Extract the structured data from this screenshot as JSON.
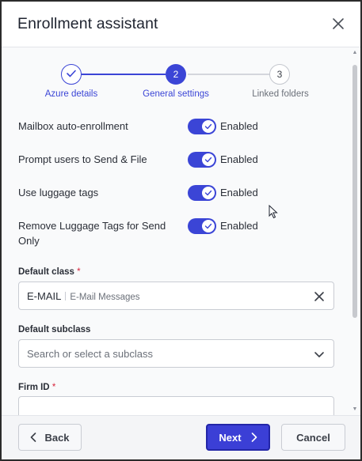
{
  "dialog": {
    "title": "Enrollment assistant",
    "close_icon": "close-icon"
  },
  "stepper": {
    "steps": [
      {
        "label": "Azure details",
        "number": "",
        "state": "completed"
      },
      {
        "label": "General settings",
        "number": "2",
        "state": "active"
      },
      {
        "label": "Linked folders",
        "number": "3",
        "state": "pending"
      }
    ]
  },
  "settings": [
    {
      "label": "Mailbox auto-enrollment",
      "toggle_on": true,
      "state_text": "Enabled"
    },
    {
      "label": "Prompt users to Send & File",
      "toggle_on": true,
      "state_text": "Enabled"
    },
    {
      "label": "Use luggage tags",
      "toggle_on": true,
      "state_text": "Enabled"
    },
    {
      "label": "Remove Luggage Tags for Send Only",
      "toggle_on": true,
      "state_text": "Enabled"
    }
  ],
  "fields": {
    "default_class": {
      "label": "Default class",
      "required_mark": "*",
      "value": "E-MAIL",
      "value_description": "E-Mail Messages"
    },
    "default_subclass": {
      "label": "Default subclass",
      "placeholder": "Search or select a subclass"
    },
    "firm_id": {
      "label": "Firm ID",
      "required_mark": "*",
      "value": ""
    }
  },
  "footer": {
    "back_label": "Back",
    "next_label": "Next",
    "cancel_label": "Cancel"
  },
  "colors": {
    "accent": "#3b45d6",
    "required": "#d7263d"
  }
}
